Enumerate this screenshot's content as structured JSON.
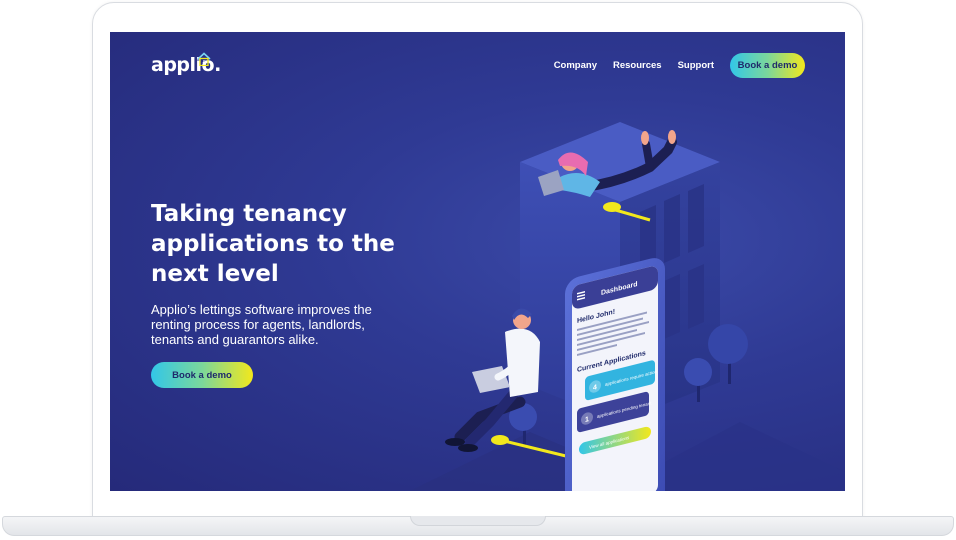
{
  "brand": {
    "name": "applio",
    "dot": "."
  },
  "nav": {
    "links": [
      "Company",
      "Resources",
      "Support"
    ],
    "cta_label": "Book a demo"
  },
  "hero": {
    "title": "Taking tenancy applications to the next level",
    "subtitle": "Applio’s lettings software improves the renting process for agents, landlords, tenants and guarantors alike.",
    "cta_label": "Book a demo"
  },
  "phone": {
    "header": "Dashboard",
    "greeting": "Hello John!",
    "intro": "Below is an overview of current applications. If you have any that require action, please click on View All Applications. If you have any issues please contact support.",
    "section_title": "Current Applications",
    "cards": [
      {
        "count": "4",
        "label": "applications require action"
      },
      {
        "count": "1",
        "label": "applications pending tenant"
      }
    ],
    "view_all_label": "View all applications"
  },
  "colors": {
    "background": "#2b3389",
    "accent_start": "#32c6e8",
    "accent_end": "#f2e81c",
    "brand_dark": "#1f2a6b"
  }
}
